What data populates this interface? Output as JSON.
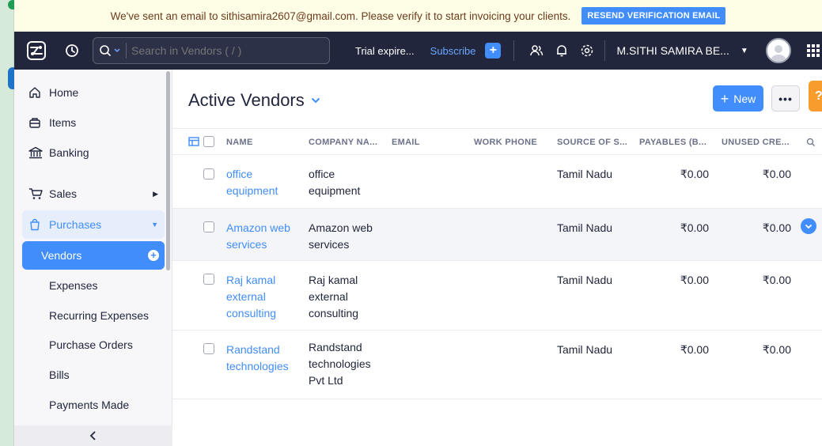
{
  "banner": {
    "message": "We've sent an email to sithisamira2607@gmail.com. Please verify it to start invoicing your clients.",
    "resend_label": "RESEND VERIFICATION EMAIL"
  },
  "topbar": {
    "search_placeholder": "Search in Vendors ( / )",
    "trial_text": "Trial expire...",
    "subscribe_label": "Subscribe",
    "org_name": "M.SITHI SAMIRA BE..."
  },
  "sidebar": {
    "items": [
      {
        "label": "Home",
        "icon": "home-icon"
      },
      {
        "label": "Items",
        "icon": "items-icon"
      },
      {
        "label": "Banking",
        "icon": "bank-icon"
      },
      {
        "label": "Sales",
        "icon": "cart-icon"
      },
      {
        "label": "Purchases",
        "icon": "bag-icon"
      }
    ],
    "purchases_sub": [
      "Vendors",
      "Expenses",
      "Recurring Expenses",
      "Purchase Orders",
      "Bills",
      "Payments Made"
    ],
    "active_item": "Vendors"
  },
  "main": {
    "title": "Active Vendors",
    "new_label": "New",
    "more_label": "•••",
    "help_label": "?",
    "columns": [
      "NAME",
      "COMPANY NA...",
      "EMAIL",
      "WORK PHONE",
      "SOURCE OF S...",
      "PAYABLES (B...",
      "UNUSED CRE..."
    ],
    "rows": [
      {
        "name": [
          "office",
          "equipment"
        ],
        "company": [
          "office",
          "equipment"
        ],
        "email": "",
        "phone": "",
        "source": "Tamil Nadu",
        "payables": "₹0.00",
        "unused": "₹0.00"
      },
      {
        "name": [
          "Amazon web",
          "services"
        ],
        "company": [
          "Amazon web",
          "services"
        ],
        "email": "",
        "phone": "",
        "source": "Tamil Nadu",
        "payables": "₹0.00",
        "unused": "₹0.00"
      },
      {
        "name": [
          "Raj kamal",
          "external",
          "consulting"
        ],
        "company": [
          "Raj kamal",
          "external",
          "consulting"
        ],
        "email": "",
        "phone": "",
        "source": "Tamil Nadu",
        "payables": "₹0.00",
        "unused": "₹0.00"
      },
      {
        "name": [
          "Randstand",
          "technologies"
        ],
        "company": [
          "Randstand",
          "technologies",
          "Pvt Ltd"
        ],
        "email": "",
        "phone": "",
        "source": "Tamil Nadu",
        "payables": "₹0.00",
        "unused": "₹0.00"
      }
    ]
  },
  "colors": {
    "accent": "#408dfb",
    "topbar": "#21263c",
    "banner_bg": "#fefde6",
    "help": "#f79c2d"
  }
}
